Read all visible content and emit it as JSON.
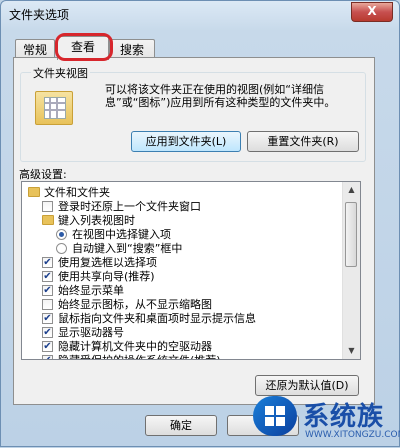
{
  "window": {
    "title": "文件夹选项",
    "close_glyph": "X"
  },
  "tabs": [
    {
      "label": "常规"
    },
    {
      "label": "查看"
    },
    {
      "label": "搜索"
    }
  ],
  "folder_view": {
    "title": "文件夹视图",
    "description": "可以将该文件夹正在使用的视图(例如“详细信息”或“图标”)应用到所有这种类型的文件夹中。",
    "apply_button": "应用到文件夹(L)",
    "reset_button": "重置文件夹(R)"
  },
  "advanced": {
    "label": "高级设置:",
    "items": [
      {
        "kind": "folder",
        "level": 0,
        "label": "文件和文件夹"
      },
      {
        "kind": "checkbox",
        "level": 1,
        "checked": false,
        "label": "登录时还原上一个文件夹窗口"
      },
      {
        "kind": "folder",
        "level": 1,
        "label": "键入列表视图时"
      },
      {
        "kind": "radio",
        "level": 2,
        "checked": true,
        "label": "在视图中选择键入项"
      },
      {
        "kind": "radio",
        "level": 2,
        "checked": false,
        "label": "自动键入到“搜索”框中"
      },
      {
        "kind": "checkbox",
        "level": 1,
        "checked": true,
        "label": "使用复选框以选择项"
      },
      {
        "kind": "checkbox",
        "level": 1,
        "checked": true,
        "label": "使用共享向导(推荐)"
      },
      {
        "kind": "checkbox",
        "level": 1,
        "checked": true,
        "label": "始终显示菜单"
      },
      {
        "kind": "checkbox",
        "level": 1,
        "checked": false,
        "label": "始终显示图标，从不显示缩略图"
      },
      {
        "kind": "checkbox",
        "level": 1,
        "checked": true,
        "label": "鼠标指向文件夹和桌面项时显示提示信息"
      },
      {
        "kind": "checkbox",
        "level": 1,
        "checked": true,
        "label": "显示驱动器号"
      },
      {
        "kind": "checkbox",
        "level": 1,
        "checked": true,
        "label": "隐藏计算机文件夹中的空驱动器"
      },
      {
        "kind": "checkbox",
        "level": 1,
        "checked": true,
        "label": "隐藏受保护的操作系统文件(推荐)"
      }
    ],
    "restore_button": "还原为默认值(D)"
  },
  "footer": {
    "ok_button": "确定",
    "cancel_button": "取"
  },
  "watermark": {
    "brand": "系统族",
    "url": "WWW.XITONGZU.COM"
  }
}
